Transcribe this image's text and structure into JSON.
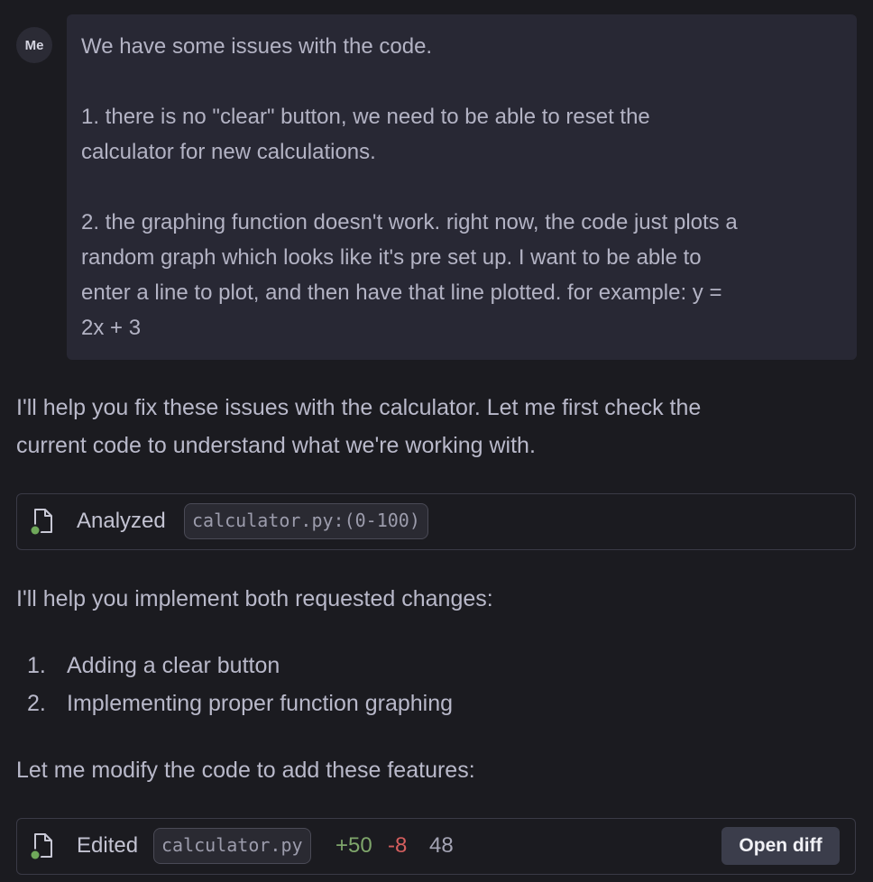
{
  "user_message": {
    "avatar_label": "Me",
    "lines": [
      "We have some issues with the code.",
      "",
      "1. there is no \"clear\" button, we need to be able to reset the",
      "calculator for new calculations.",
      "",
      "2. the graphing function doesn't work. right now, the code just plots a",
      "random graph which looks like it's pre set up. I want to be able to",
      "enter a line to plot, and then have that line plotted. for example: y =",
      "2x + 3"
    ]
  },
  "assistant": {
    "intro_line1": "I'll help you fix these issues with the calculator. Let me first check the",
    "intro_line2": "current code to understand what we're working with.",
    "analyzed_card": {
      "icon": "file-icon",
      "label": "Analyzed",
      "file_ref": "calculator.py:(0-100)"
    },
    "plan_intro": "I'll help you implement both requested changes:",
    "plan_items": [
      {
        "num": "1.",
        "text": "Adding a clear button"
      },
      {
        "num": "2.",
        "text": "Implementing proper function graphing"
      }
    ],
    "modify_line": "Let me modify the code to add these features:",
    "edited_card": {
      "icon": "file-icon",
      "label": "Edited",
      "file_ref": "calculator.py",
      "additions": "+50",
      "deletions": "-8",
      "net": "48",
      "open_diff_label": "Open diff"
    }
  },
  "colors": {
    "background": "#1b1b20",
    "bubble": "#282834",
    "added": "#7fa66b",
    "removed": "#d45e5e",
    "status_dot": "#6fa85a"
  }
}
